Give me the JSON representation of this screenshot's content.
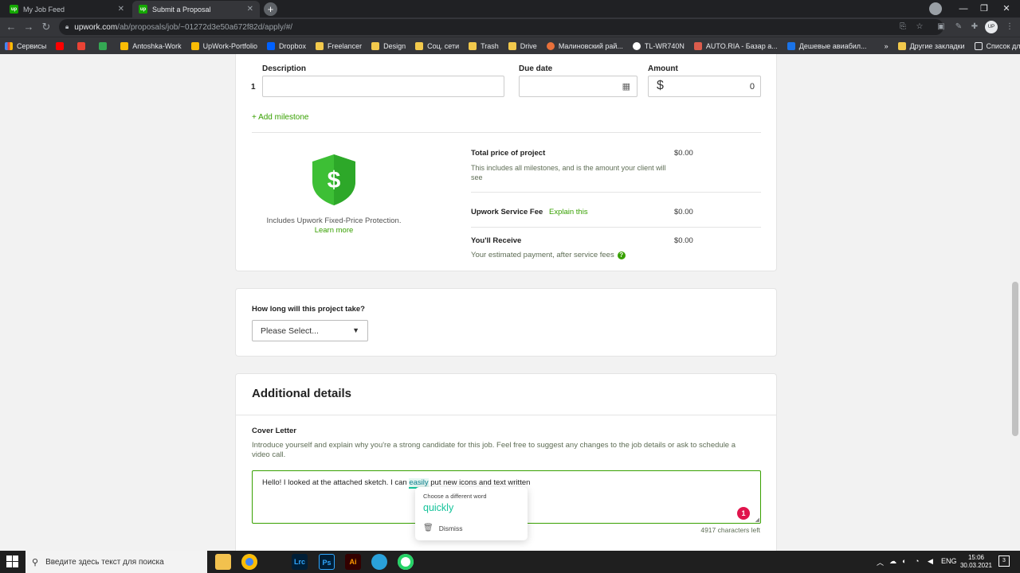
{
  "browser": {
    "tabs": [
      {
        "title": "My Job Feed",
        "favicon": "up"
      },
      {
        "title": "Submit a Proposal",
        "favicon": "up"
      }
    ],
    "url_host": "upwork.com",
    "url_path": "/ab/proposals/job/~01272d3e50a672f82d/apply/#/",
    "bookmarks": [
      "Сервисы",
      "",
      "",
      "",
      "Antoshka-Work",
      "UpWork-Portfolio",
      "Dropbox",
      "Freelancer",
      "Design",
      "Соц. сети",
      "Trash",
      "Drive",
      "Малиновский рай...",
      "TL-WR740N",
      "AUTO.RIA - Базар а...",
      "Дешевые авиабил..."
    ],
    "bookmarks_more": "»",
    "bookmarks_other": "Другие закладки",
    "reading_list": "Список для чтения"
  },
  "milestone": {
    "description_label": "Description",
    "due_date_label": "Due date",
    "amount_label": "Amount",
    "row_number": "1",
    "currency_symbol": "$",
    "amount_value": "0",
    "add_milestone": "+ Add milestone"
  },
  "protection": {
    "text": "Includes Upwork Fixed-Price Protection.",
    "learn_more": "Learn more"
  },
  "pricing": {
    "total_label": "Total price of project",
    "total_value": "$0.00",
    "total_desc": "This includes all milestones, and is the amount your client will see",
    "fee_label": "Upwork Service Fee",
    "fee_link": "Explain this",
    "fee_value": "$0.00",
    "receive_label": "You'll Receive",
    "receive_value": "$0.00",
    "receive_desc": "Your estimated payment, after service fees"
  },
  "duration": {
    "question": "How long will this project take?",
    "select_value": "Please Select..."
  },
  "additional": {
    "title": "Additional details",
    "cover_label": "Cover Letter",
    "cover_desc": "Introduce yourself and explain why you're a strong candidate for this job. Feel free to suggest any changes to the job details or ask to schedule a video call.",
    "text_before": "Hello! I looked at the attached sketch. I can ",
    "text_flagged": "easily",
    "text_after": " put new icons and text written",
    "issue_count": "1",
    "chars_left": "4917 characters left"
  },
  "suggestion": {
    "heading": "Choose a different word",
    "word": "quickly",
    "dismiss": "Dismiss"
  },
  "taskbar": {
    "search_placeholder": "Введите здесь текст для поиска",
    "apps": [
      "",
      "",
      "",
      "Lrc",
      "Ps",
      "Ai",
      "",
      ""
    ],
    "lang": "ENG",
    "time": "15:06",
    "date": "30.03.2021",
    "notifications": "3"
  },
  "colors": {
    "accent": "#37a000",
    "shield": "#3dbf35",
    "badge": "#e0144c",
    "focus": "#37a000"
  }
}
